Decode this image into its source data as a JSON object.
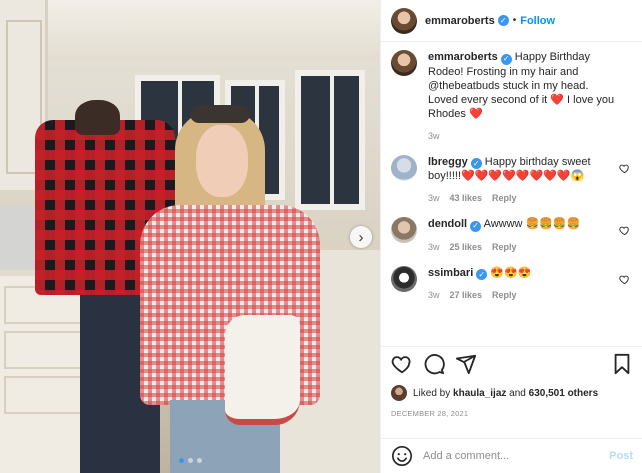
{
  "post": {
    "username": "emmaroberts",
    "follow_label": "Follow",
    "separator": "•"
  },
  "caption": {
    "username": "emmaroberts",
    "text": "Happy Birthday Rodeo! Frosting in my hair and @thebeatbuds stuck in my head. Loved every second of it ❤️ I love you Rhodes ❤️",
    "time": "3w"
  },
  "comments": [
    {
      "username": "lbreggy",
      "verified": true,
      "text": "Happy birthday sweet boy!!!!!❤️❤️❤️❤️❤️❤️❤️❤️😱",
      "time": "3w",
      "likes": "43 likes",
      "reply": "Reply"
    },
    {
      "username": "dendoll",
      "verified": true,
      "text": "Awwww 🍔🍔🍔🍔",
      "time": "3w",
      "likes": "25 likes",
      "reply": "Reply"
    },
    {
      "username": "ssimbari",
      "verified": true,
      "text": "😍😍😍",
      "time": "3w",
      "likes": "27 likes",
      "reply": "Reply"
    }
  ],
  "likes_line": {
    "prefix": "Liked by ",
    "user": "khaula_ijaz",
    "middle": " and ",
    "count": "630,501 others"
  },
  "date": "DECEMBER 28, 2021",
  "add_comment": {
    "placeholder": "Add a comment...",
    "post_label": "Post"
  },
  "carousel": {
    "total": 3,
    "active_index": 0,
    "next_glyph": "›"
  },
  "colors": {
    "accent": "#0095f6",
    "verified": "#3897f0",
    "heart": "#ed4956"
  }
}
